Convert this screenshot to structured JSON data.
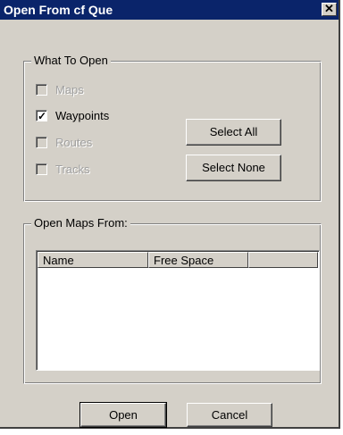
{
  "window": {
    "title": "Open From cf Que",
    "close_glyph": "✕"
  },
  "what_to_open": {
    "legend": "What To Open",
    "items": [
      {
        "label": "Maps",
        "checked": false,
        "enabled": false
      },
      {
        "label": "Waypoints",
        "checked": true,
        "enabled": true
      },
      {
        "label": "Routes",
        "checked": false,
        "enabled": false
      },
      {
        "label": "Tracks",
        "checked": false,
        "enabled": false
      }
    ],
    "select_all_label": "Select All",
    "select_none_label": "Select None"
  },
  "open_maps_from": {
    "legend": "Open Maps From:",
    "columns": [
      "Name",
      "Free Space",
      ""
    ]
  },
  "footer": {
    "open_label": "Open",
    "cancel_label": "Cancel"
  },
  "icons": {
    "close": "close-icon",
    "checkmark": "checkmark-icon"
  }
}
